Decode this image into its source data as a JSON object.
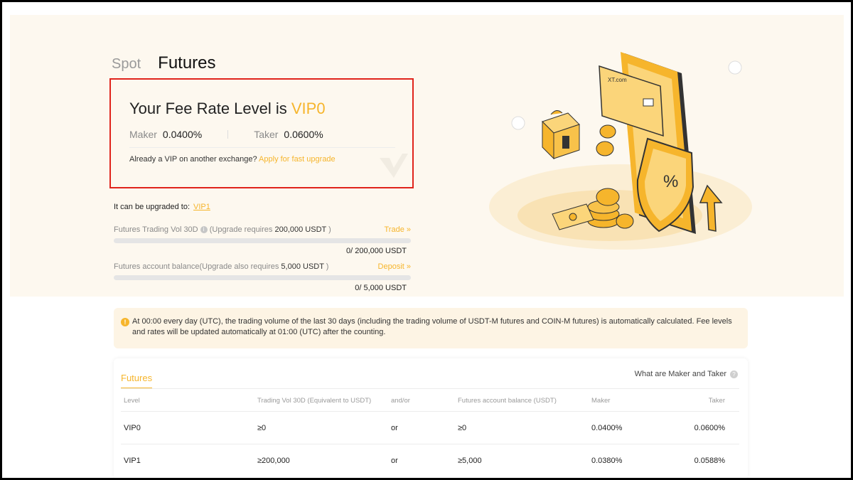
{
  "tabs": {
    "spot": "Spot",
    "futures": "Futures"
  },
  "fee_card": {
    "title_prefix": "Your Fee Rate Level is ",
    "level": "VIP0",
    "maker_label": "Maker",
    "maker_value": "0.0400%",
    "taker_label": "Taker",
    "taker_value": "0.0600%",
    "vip_question": "Already a VIP on another exchange?",
    "apply_link": "Apply for fast upgrade"
  },
  "upgrade": {
    "text": "It can be upgraded to:",
    "target_level": "VIP1",
    "trading": {
      "label_prefix": "Futures Trading Vol 30D",
      "label_mid": "(Upgrade requires ",
      "amount": "200,000 USDT",
      "label_suffix": " )",
      "action": "Trade",
      "progress": 0,
      "value_text": "0/ 200,000 USDT"
    },
    "balance": {
      "label_prefix": "Futures account balance(Upgrade also requires ",
      "amount": "5,000 USDT",
      "label_suffix": " )",
      "action": "Deposit",
      "progress": 0,
      "value_text": "0/ 5,000 USDT"
    }
  },
  "notice": {
    "text": "At 00:00 every day (UTC), the trading volume of the last 30 days (including the trading volume of USDT-M futures and COIN-M futures) is automatically calculated. Fee levels and rates will be updated automatically at 01:00 (UTC) after the counting."
  },
  "table": {
    "tab": "Futures",
    "help_link": "What are Maker and Taker",
    "headers": [
      "Level",
      "Trading Vol 30D (Equivalent to USDT)",
      "and/or",
      "Futures account balance (USDT)",
      "Maker",
      "Taker"
    ],
    "rows": [
      [
        "VIP0",
        "≥0",
        "or",
        "≥0",
        "0.0400%",
        "0.0600%"
      ],
      [
        "VIP1",
        "≥200,000",
        "or",
        "≥5,000",
        "0.0380%",
        "0.0588%"
      ]
    ]
  },
  "illustration": {
    "card_brand": "XT.com",
    "shield_symbol": "%"
  },
  "colors": {
    "accent": "#f6b52c",
    "highlight_border": "#e0241c",
    "hero_bg": "#fdf8ef"
  }
}
